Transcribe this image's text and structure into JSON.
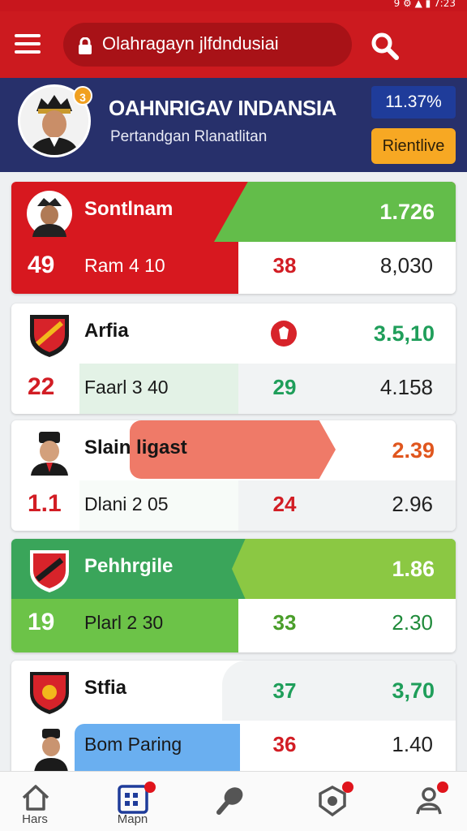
{
  "status_bar": {
    "text": "9 ⚙ ▲ ▮ 7:23"
  },
  "app_bar": {
    "search_text": "Olahragayn jlfdndusiai"
  },
  "header": {
    "title": "OAHNRIGAV INDANSIA",
    "subtitle": "Pertandgan Rlanatlitan",
    "badge": "3",
    "value": "11.37%",
    "button_label": "Rientlive"
  },
  "teams": [
    {
      "name": "Sontlnam",
      "odds": "1.726",
      "rank": "49",
      "match": "Ram 4 10",
      "score": "38",
      "total": "8,030"
    },
    {
      "name": "Arfia",
      "odds": "3.5,10",
      "rank": "22",
      "match": "Faarl 3 40",
      "score": "29",
      "total": "4.158"
    },
    {
      "name": "Slain ligast",
      "odds": "2.39",
      "rank": "1.1",
      "match": "Dlani 2 05",
      "score": "24",
      "total": "2.96"
    },
    {
      "name": "Pehhrgile",
      "odds": "1.86",
      "rank": "19",
      "match": "Plarl 2 30",
      "score": "33",
      "total": "2.30"
    },
    {
      "name": "Stfia",
      "odds": "3,70",
      "score_top": "37",
      "match": "Bom Paring",
      "score": "36",
      "total": "1.40"
    }
  ],
  "nav": [
    {
      "label": "Hars",
      "icon": "home-icon"
    },
    {
      "label": "Mapn",
      "icon": "calendar-icon"
    },
    {
      "label": "",
      "icon": "whistle-icon"
    },
    {
      "label": "",
      "icon": "badge-icon"
    },
    {
      "label": "",
      "icon": "profile-icon"
    }
  ],
  "colors": {
    "red": "#cc1a1f",
    "navy": "#27306b",
    "green": "#5bbd45",
    "orange": "#f7a823",
    "blue": "#6aaff0"
  }
}
